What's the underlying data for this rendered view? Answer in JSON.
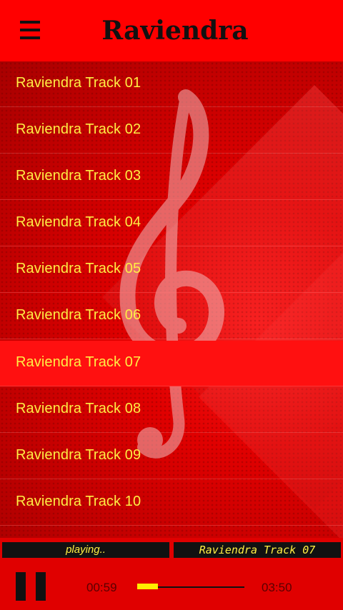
{
  "header": {
    "title": "Raviendra",
    "menu_icon": "hamburger-menu-icon"
  },
  "tracks": [
    {
      "label": "Raviendra Track 01"
    },
    {
      "label": "Raviendra Track 02"
    },
    {
      "label": "Raviendra Track 03"
    },
    {
      "label": "Raviendra Track 04"
    },
    {
      "label": "Raviendra Track 05"
    },
    {
      "label": "Raviendra Track 06"
    },
    {
      "label": "Raviendra Track 07"
    },
    {
      "label": "Raviendra Track 08"
    },
    {
      "label": "Raviendra Track 09"
    },
    {
      "label": "Raviendra Track 10"
    }
  ],
  "active_track_index": 6,
  "player": {
    "status": "playing..",
    "now_playing": "Raviendra Track 07",
    "current_time": "00:59",
    "total_time": "03:50",
    "progress_fraction": 0.26,
    "pause_icon": "pause-icon"
  },
  "colors": {
    "header_bg": "#ff0000",
    "track_text": "#ffee44",
    "active_row": "#ff1010",
    "status_box": "#111111"
  }
}
